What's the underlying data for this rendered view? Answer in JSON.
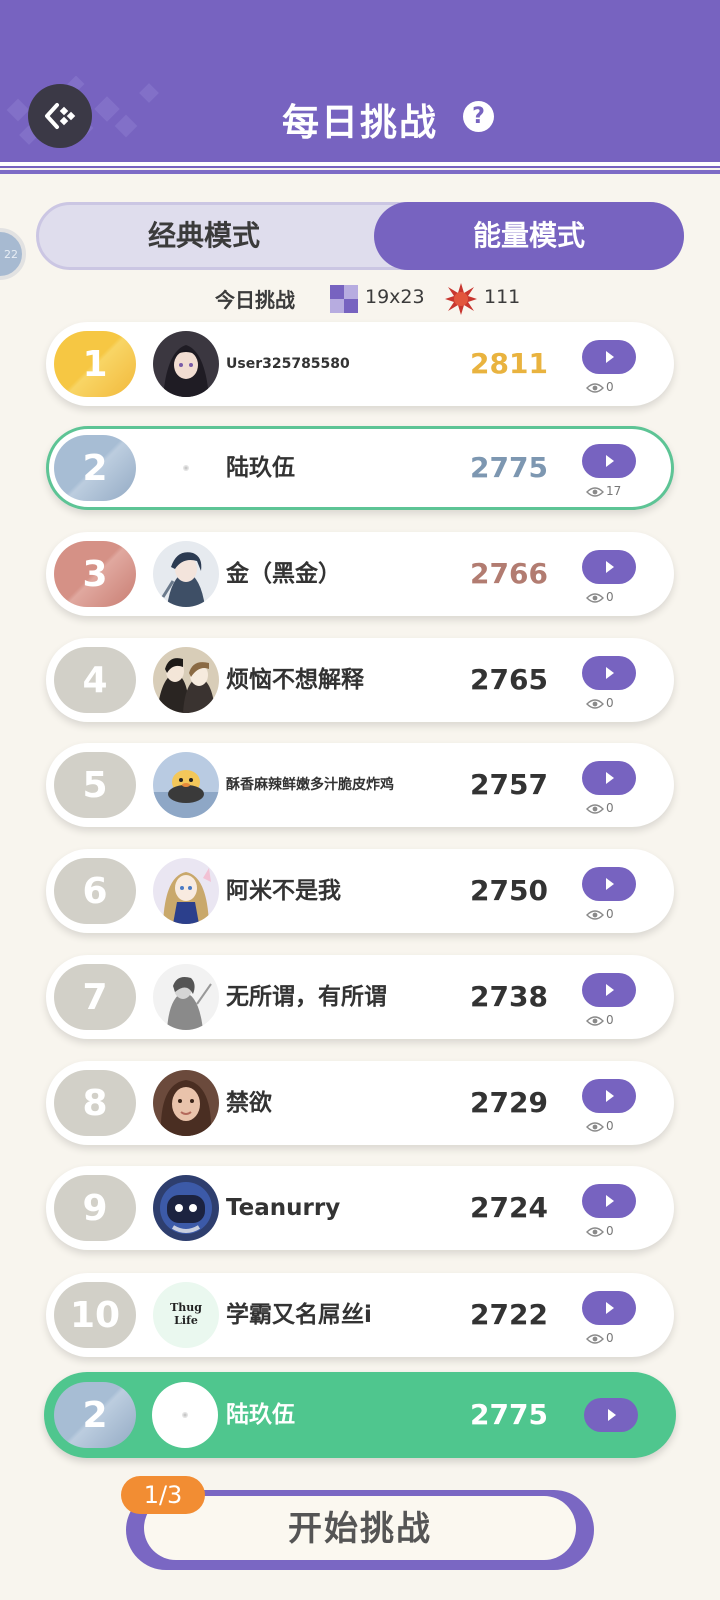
{
  "header": {
    "title": "每日挑战",
    "help_icon": "question-circle-icon",
    "back_icon": "back-arrow-icon",
    "background": "#7763c0"
  },
  "edge_bubble": {
    "text": "22"
  },
  "modes": {
    "classic": "经典模式",
    "energy": "能量模式",
    "active": "energy"
  },
  "challenge": {
    "label": "今日挑战",
    "grid_size": "19x23",
    "energy_count": "111"
  },
  "colors": {
    "gold": "#f6c743",
    "silver": "#a7bdd4",
    "bronze": "#d59186",
    "default": "#d2d0c8",
    "accent": "#7763c0",
    "highlight": "#4fc68e",
    "badge": "#f28d33"
  },
  "rankings": [
    {
      "rank": "1",
      "name": "User325785580",
      "score": "2811",
      "views": "0",
      "avatar": "dark-haired-anime-avatar"
    },
    {
      "rank": "2",
      "name": "陆玖伍",
      "score": "2775",
      "views": "17",
      "avatar": "blank-avatar"
    },
    {
      "rank": "3",
      "name": "金（黑金）",
      "score": "2766",
      "views": "0",
      "avatar": "anime-boy-avatar"
    },
    {
      "rank": "4",
      "name": "烦恼不想解释",
      "score": "2765",
      "views": "0",
      "avatar": "manga-pair-avatar"
    },
    {
      "rank": "5",
      "name": "酥香麻辣鲜嫩多汁脆皮炸鸡",
      "score": "2757",
      "views": "0",
      "avatar": "duck-avatar"
    },
    {
      "rank": "6",
      "name": "阿米不是我",
      "score": "2750",
      "views": "0",
      "avatar": "anime-girl-avatar"
    },
    {
      "rank": "7",
      "name": "无所谓，有所谓",
      "score": "2738",
      "views": "0",
      "avatar": "sketch-avatar"
    },
    {
      "rank": "8",
      "name": "禁欲",
      "score": "2729",
      "views": "0",
      "avatar": "girl-photo-avatar"
    },
    {
      "rank": "9",
      "name": "Teanurry",
      "score": "2724",
      "views": "0",
      "avatar": "robot-avatar"
    },
    {
      "rank": "10",
      "name": "学霸又名屌丝i",
      "score": "2722",
      "views": "0",
      "avatar": "thug-life-avatar"
    }
  ],
  "my_rank": {
    "rank": "2",
    "name": "陆玖伍",
    "score": "2775"
  },
  "thug_life_text": "Thug Life",
  "start": {
    "label": "开始挑战",
    "attempts": "1/3"
  }
}
